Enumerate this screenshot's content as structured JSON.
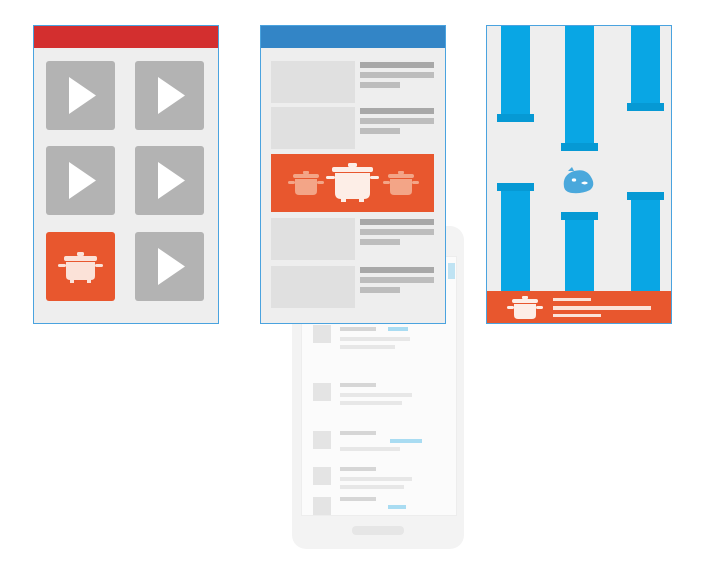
{
  "panels": {
    "video_grid": {
      "name": "video-grid-panel",
      "bar_color": "#d32f2f",
      "tile_color": "#b3b3b3",
      "highlight_color": "#e8572e",
      "tiles": [
        "play",
        "play",
        "play",
        "play",
        "cookware",
        "play"
      ]
    },
    "article_list": {
      "name": "article-list-panel",
      "bar_color": "#3385c6",
      "banner_color": "#e8572e"
    },
    "flappy_game": {
      "name": "flappy-game-panel",
      "pipe_color": "#09a6e4",
      "bird_color": "#4aa8dc",
      "ad_color": "#e8572e"
    }
  },
  "phone": {
    "name": "phone-mockup",
    "accent": "#9fd6ef"
  },
  "icons": {
    "play": "play-icon",
    "cookware": "cooking-pot-icon",
    "bird": "bird-icon"
  }
}
